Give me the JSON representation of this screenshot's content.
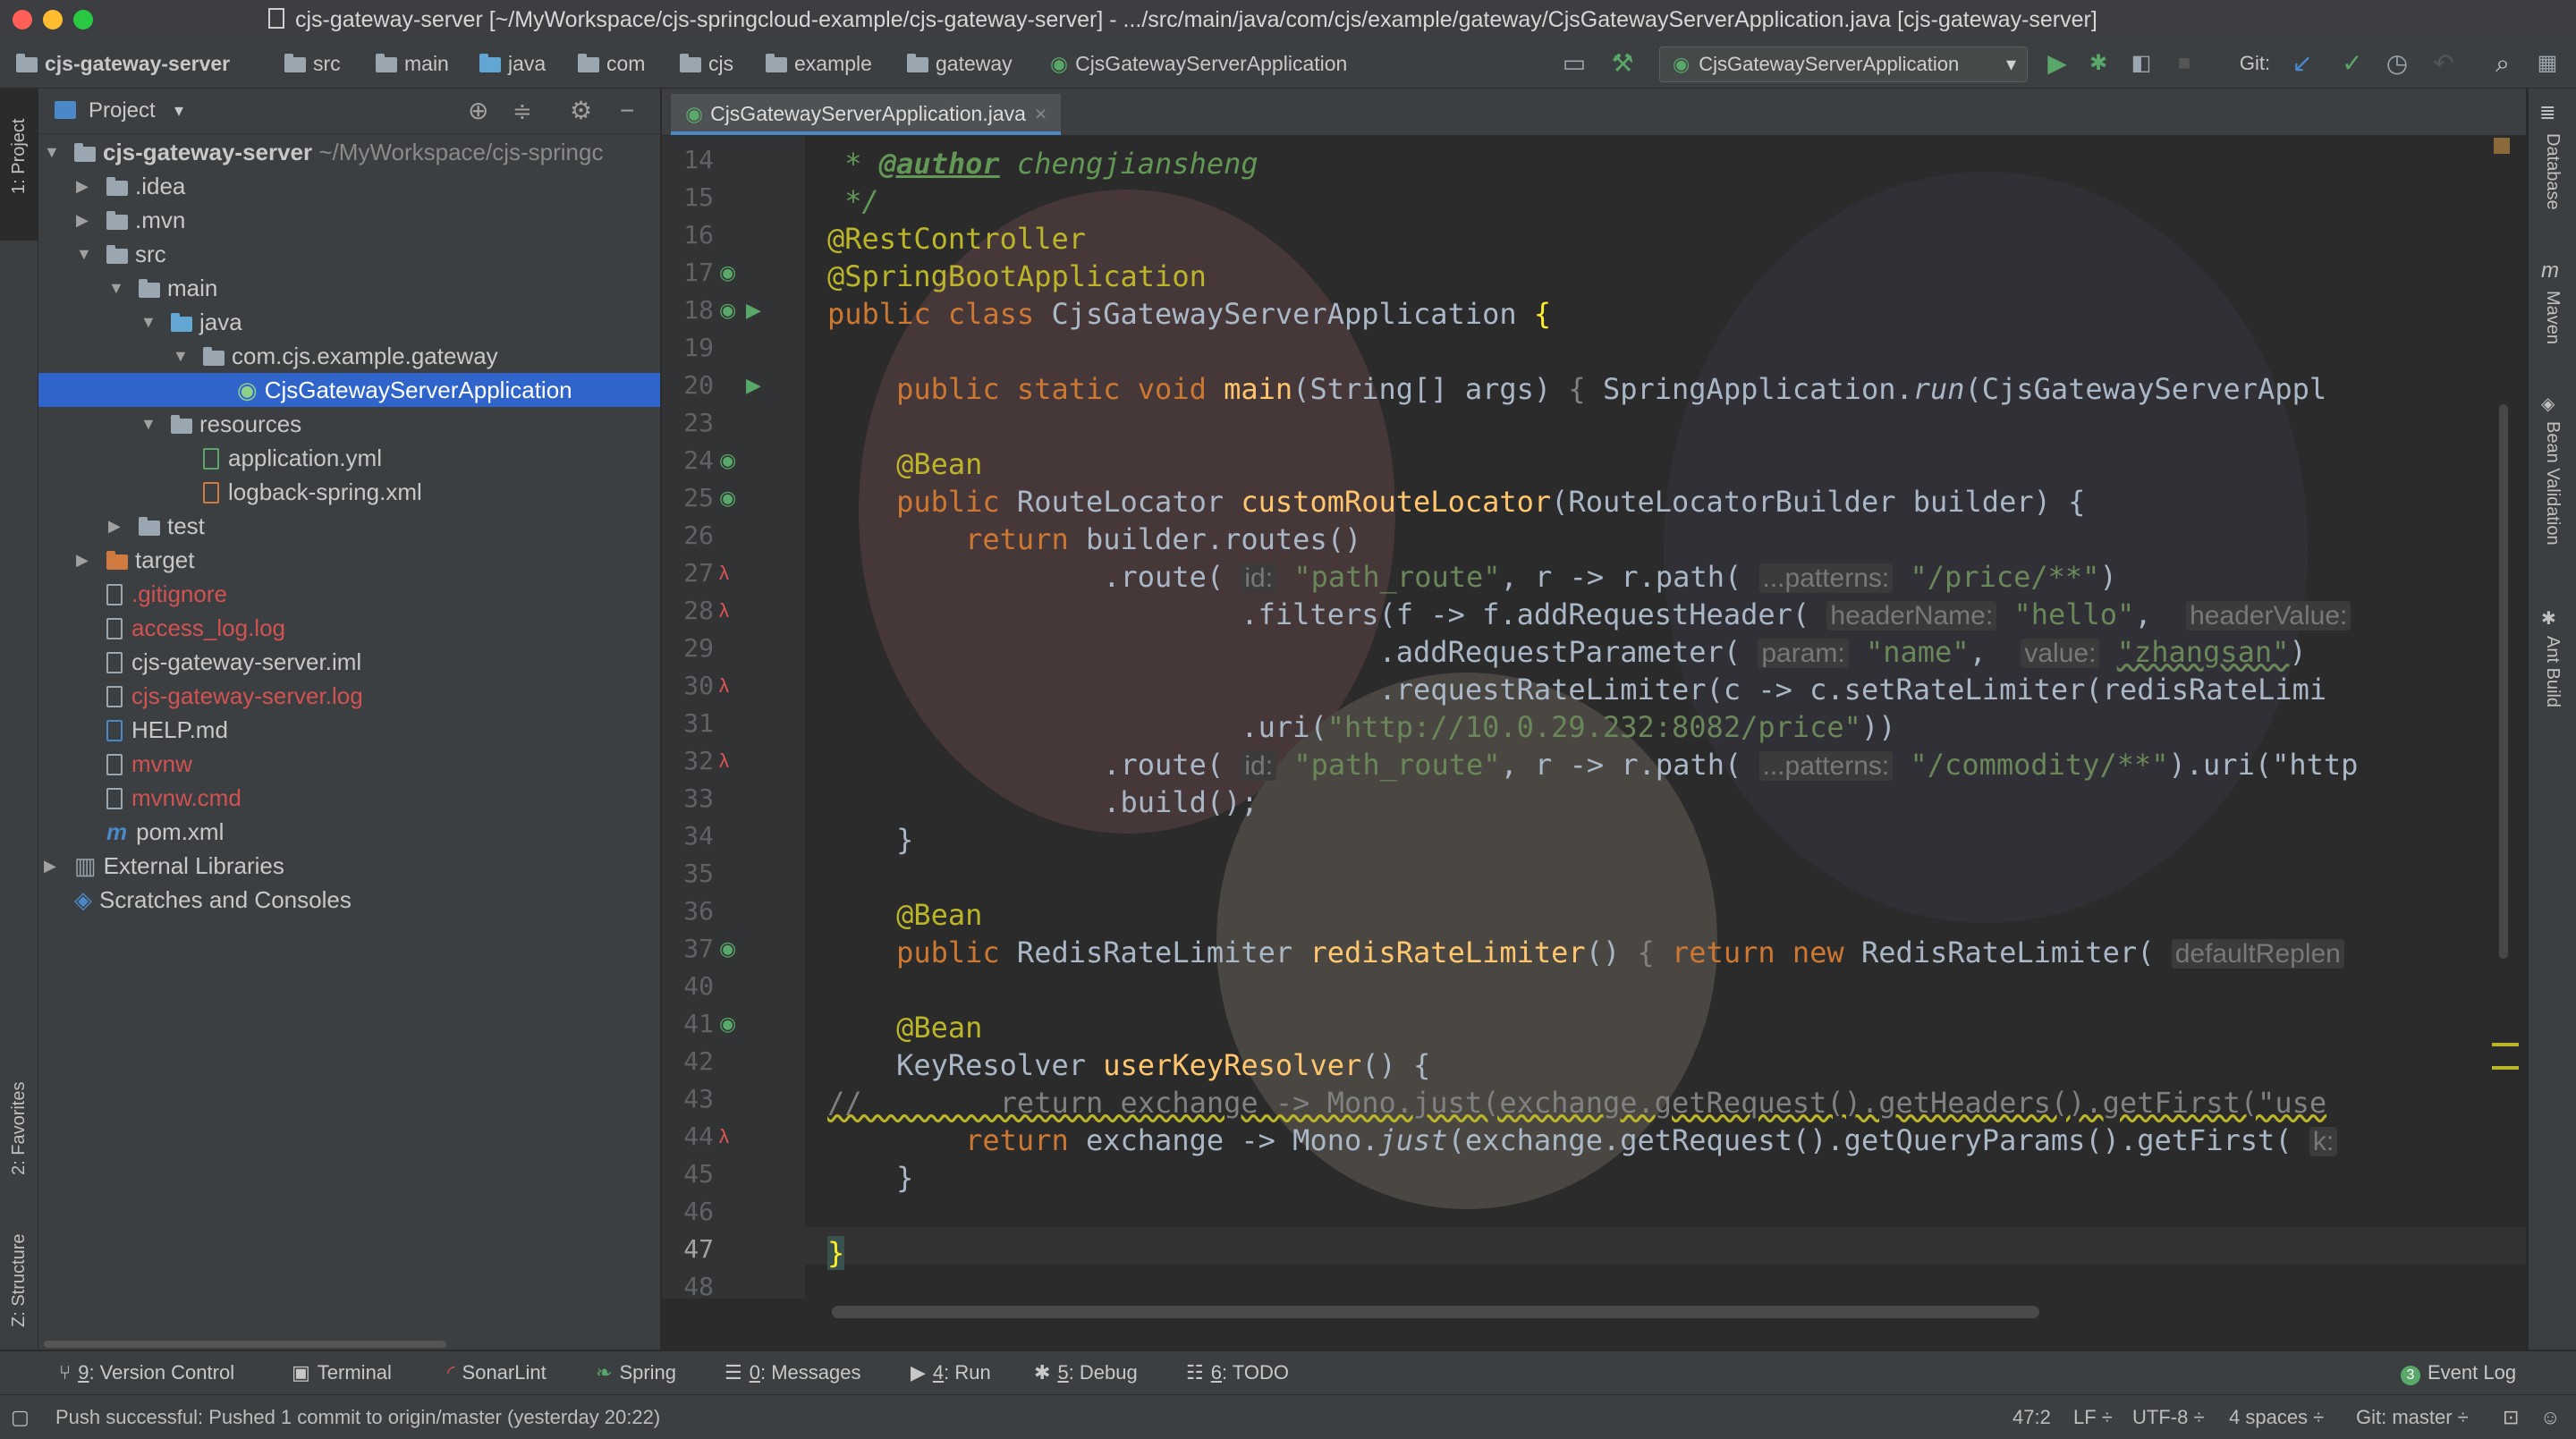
{
  "window": {
    "title": "cjs-gateway-server [~/MyWorkspace/cjs-springcloud-example/cjs-gateway-server] - .../src/main/java/com/cjs/example/gateway/CjsGatewayServerApplication.java [cjs-gateway-server]"
  },
  "breadcrumbs": [
    "cjs-gateway-server",
    "src",
    "main",
    "java",
    "com",
    "cjs",
    "example",
    "gateway",
    "CjsGatewayServerApplication"
  ],
  "toolbar": {
    "run_config": "CjsGatewayServerApplication",
    "git_label": "Git:"
  },
  "left_strip": {
    "project_tab": "1: Project",
    "favorites_tab": "2: Favorites",
    "structure_tab": "Z: Structure"
  },
  "project": {
    "header_label": "Project",
    "tree": [
      {
        "label": "cjs-gateway-server",
        "suffix": "~/MyWorkspace/cjs-springc",
        "icon": "module-folder-icon"
      },
      {
        "label": ".idea",
        "icon": "folder-icon"
      },
      {
        "label": ".mvn",
        "icon": "folder-icon"
      },
      {
        "label": "src",
        "icon": "folder-icon"
      },
      {
        "label": "main",
        "icon": "folder-icon"
      },
      {
        "label": "java",
        "icon": "source-folder-icon"
      },
      {
        "label": "com.cjs.example.gateway",
        "icon": "package-icon"
      },
      {
        "label": "CjsGatewayServerApplication",
        "icon": "spring-boot-class-icon"
      },
      {
        "label": "resources",
        "icon": "resources-folder-icon"
      },
      {
        "label": "application.yml",
        "icon": "yaml-file-icon"
      },
      {
        "label": "logback-spring.xml",
        "icon": "xml-file-icon"
      },
      {
        "label": "test",
        "icon": "folder-icon"
      },
      {
        "label": "target",
        "icon": "excluded-folder-icon"
      },
      {
        "label": ".gitignore",
        "icon": "text-file-icon"
      },
      {
        "label": "access_log.log",
        "icon": "log-file-icon"
      },
      {
        "label": "cjs-gateway-server.iml",
        "icon": "iml-file-icon"
      },
      {
        "label": "cjs-gateway-server.log",
        "icon": "log-file-icon"
      },
      {
        "label": "HELP.md",
        "icon": "markdown-file-icon"
      },
      {
        "label": "mvnw",
        "icon": "script-file-icon"
      },
      {
        "label": "mvnw.cmd",
        "icon": "script-file-icon"
      },
      {
        "label": "pom.xml",
        "icon": "maven-icon"
      },
      {
        "label": "External Libraries",
        "icon": "library-icon"
      },
      {
        "label": "Scratches and Consoles",
        "icon": "scratch-icon"
      }
    ]
  },
  "editor": {
    "tab_label": "CjsGatewayServerApplication.java",
    "line_numbers": [
      "14",
      "15",
      "16",
      "17",
      "18",
      "19",
      "20",
      "23",
      "24",
      "25",
      "26",
      "27",
      "28",
      "29",
      "30",
      "31",
      "32",
      "33",
      "34",
      "35",
      "36",
      "37",
      "40",
      "41",
      "42",
      "43",
      "44",
      "45",
      "46",
      "47",
      "48"
    ],
    "code": {
      "l14_tag": "@author",
      "l14_name": "chengjiansheng",
      "l16": "@RestController",
      "l17": "@SpringBootApplication",
      "l18_kw": "public class",
      "l18_name": "CjsGatewayServerApplication",
      "l20_kw": "public static void",
      "l20_method": "main",
      "l20_params": "(String[] args)",
      "l20_body": "SpringApplication.",
      "l20_run": "run",
      "l20_tail": "(CjsGatewayServerAppl",
      "bean": "@Bean",
      "l25_kw": "public",
      "l25_type": "RouteLocator",
      "l25_method": "customRouteLocator",
      "l25_params": "(RouteLocatorBuilder builder) {",
      "l26_kw": "return",
      "l26_rest": "builder.routes()",
      "l27_a": ".route(",
      "l27_hint_id": "id:",
      "l27_str": "\"path_route\"",
      "l27_b": ", r -> r.path(",
      "l27_hint": "...patterns:",
      "l27_path": "\"/price/**\"",
      "l28_a": ".filters(f -> f.addRequestHeader(",
      "l28_hint1": "headerName:",
      "l28_str": "\"hello\"",
      "l28_hint2": "headerValue:",
      "l29_a": ".addRequestParameter(",
      "l29_hint1": "param:",
      "l29_str1": "\"name\"",
      "l29_hint2": "value:",
      "l29_str2": "\"zhangsan\"",
      "l30": ".requestRateLimiter(c -> c.setRateLimiter(redisRateLimi",
      "l31_a": ".uri(",
      "l31_str": "\"http://10.0.29.232:8082/price\"",
      "l32_str": "\"path_route\"",
      "l32_path": "\"/commodity/**\"",
      "l32_tail": ").uri(\"http",
      "l33": ".build();",
      "brace_close": "}",
      "l37_type": "RedisRateLimiter",
      "l37_method": "redisRateLimiter",
      "l37_return": "return new",
      "l37_new": "RedisRateLimiter(",
      "l37_hint": "defaultReplen",
      "l42_type": "KeyResolver",
      "l42_method": "userKeyResolver",
      "l42_tail": "() {",
      "l43": "//        return exchange -> Mono.just(exchange.getRequest().getHeaders().getFirst(\"use",
      "l44_a": "exchange -> Mono.",
      "l44_just": "just",
      "l44_b": "(exchange.getRequest().getQueryParams().getFirst(",
      "l44_hint": "k:"
    }
  },
  "right_strip": [
    "Database",
    "Maven",
    "Bean Validation",
    "Ant Build"
  ],
  "bottom_tabs": [
    {
      "num": "9",
      "label": ": Version Control",
      "icon": "version-control-icon"
    },
    {
      "num": "",
      "label": "Terminal",
      "icon": "terminal-icon"
    },
    {
      "num": "",
      "label": "SonarLint",
      "icon": "sonarlint-icon"
    },
    {
      "num": "",
      "label": "Spring",
      "icon": "spring-icon"
    },
    {
      "num": "0",
      "label": ": Messages",
      "icon": "messages-icon"
    },
    {
      "num": "4",
      "label": ": Run",
      "icon": "run-icon"
    },
    {
      "num": "5",
      "label": ": Debug",
      "icon": "debug-icon"
    },
    {
      "num": "6",
      "label": ": TODO",
      "icon": "todo-icon"
    }
  ],
  "event_log": {
    "count": "3",
    "label": "Event Log"
  },
  "status": {
    "message": "Push successful: Pushed 1 commit to origin/master (yesterday 20:22)",
    "position": "47:2",
    "line_sep": "LF ÷",
    "encoding": "UTF-8 ÷",
    "indent": "4 spaces ÷",
    "git_branch": "Git: master ÷"
  },
  "colors": {
    "accent": "#2f65ca",
    "keyword": "#cc7832",
    "annotation": "#bbb529",
    "string": "#6a8759",
    "method": "#ffc66d",
    "run_green": "#59a869"
  }
}
